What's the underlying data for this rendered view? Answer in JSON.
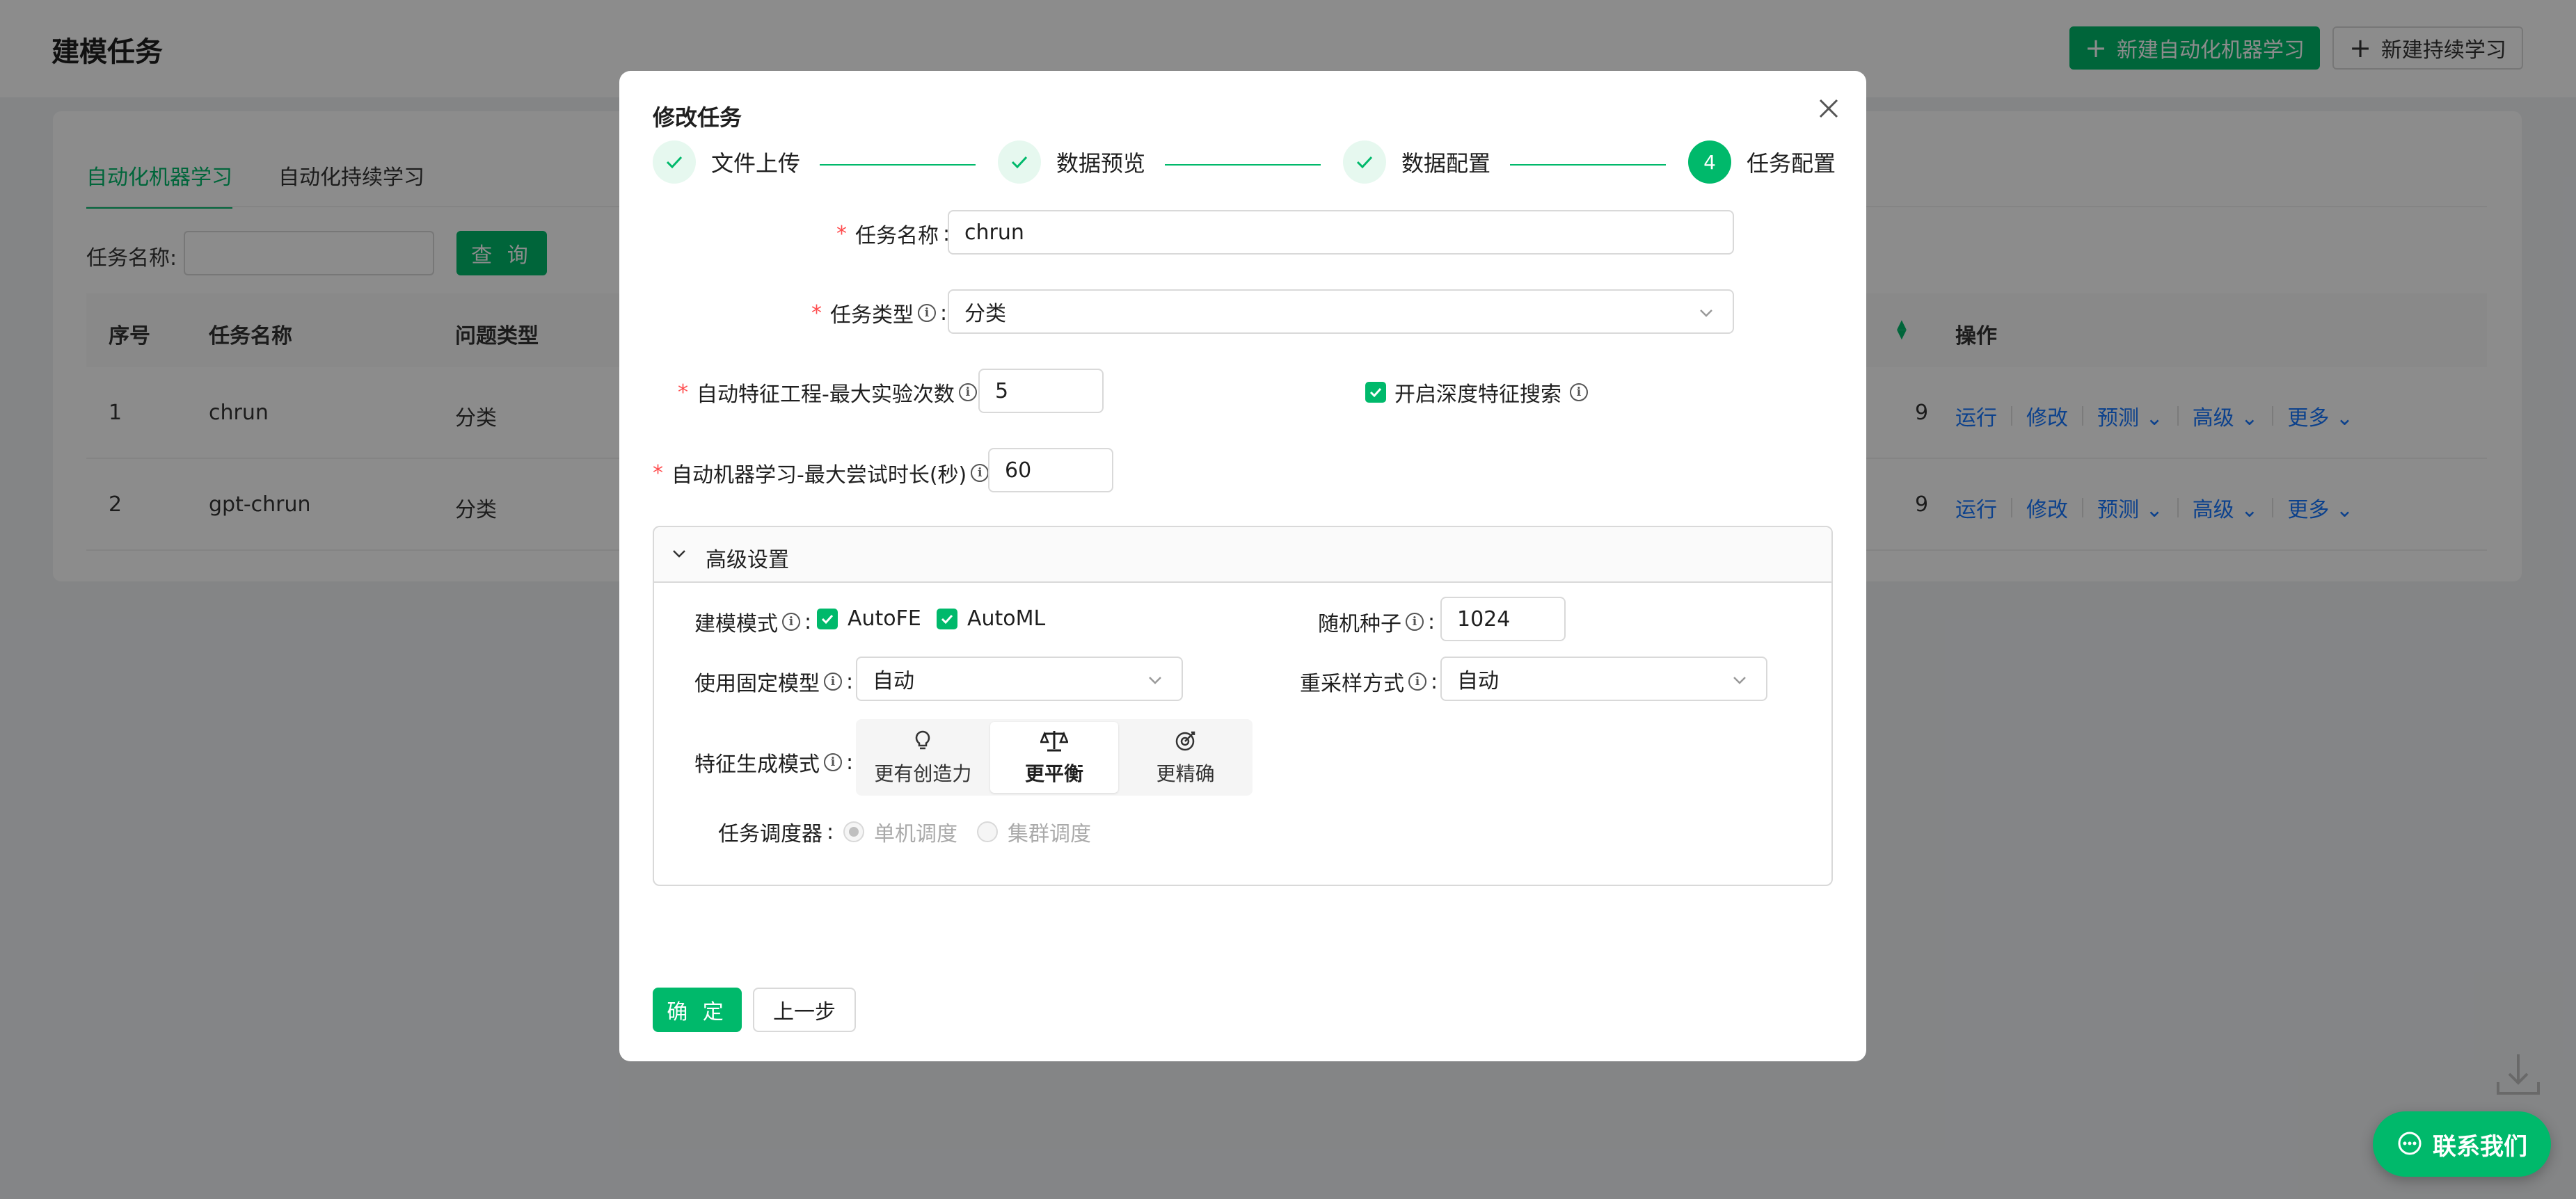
{
  "page": {
    "title": "建模任务",
    "header_buttons": {
      "new_automl": "新建自动化机器学习",
      "new_continuous": "新建持续学习"
    }
  },
  "list": {
    "tabs": [
      {
        "label": "自动化机器学习",
        "active": true
      },
      {
        "label": "自动化持续学习",
        "active": false
      }
    ],
    "search": {
      "label": "任务名称:",
      "value": "",
      "query_button": "查 询"
    },
    "columns": [
      "序号",
      "任务名称",
      "问题类型",
      "操作"
    ],
    "rows": [
      {
        "index": "1",
        "name": "chrun",
        "type": "分类",
        "partial": "9"
      },
      {
        "index": "2",
        "name": "gpt-chrun",
        "type": "分类",
        "partial": "9"
      }
    ],
    "actions": {
      "run": "运行",
      "edit": "修改",
      "predict": "预测",
      "advanced": "高级",
      "more": "更多"
    }
  },
  "modal": {
    "title": "修改任务",
    "steps": [
      {
        "label": "文件上传",
        "status": "done"
      },
      {
        "label": "数据预览",
        "status": "done"
      },
      {
        "label": "数据配置",
        "status": "done"
      },
      {
        "label": "任务配置",
        "status": "current",
        "number": "4"
      }
    ],
    "form": {
      "task_name": {
        "label": "任务名称",
        "value": "chrun"
      },
      "task_type": {
        "label": "任务类型",
        "value": "分类"
      },
      "max_trials": {
        "label": "自动特征工程-最大实验次数",
        "value": "5"
      },
      "deep_feature_search": {
        "label": "开启深度特征搜索",
        "checked": true
      },
      "max_duration": {
        "label": "自动机器学习-最大尝试时长(秒)",
        "value": "60"
      }
    },
    "advanced": {
      "title": "高级设置",
      "modeling_mode": {
        "label": "建模模式",
        "options": [
          {
            "label": "AutoFE",
            "checked": true
          },
          {
            "label": "AutoML",
            "checked": true
          }
        ]
      },
      "random_seed": {
        "label": "随机种子",
        "value": "1024"
      },
      "fixed_model": {
        "label": "使用固定模型",
        "value": "自动"
      },
      "resample": {
        "label": "重采样方式",
        "value": "自动"
      },
      "feature_mode": {
        "label": "特征生成模式",
        "options": [
          {
            "label": "更有创造力",
            "icon": "lightbulb-icon",
            "active": false
          },
          {
            "label": "更平衡",
            "icon": "balance-scale-icon",
            "active": true
          },
          {
            "label": "更精确",
            "icon": "target-icon",
            "active": false
          }
        ]
      },
      "scheduler": {
        "label": "任务调度器",
        "options": [
          {
            "label": "单机调度",
            "selected": true,
            "disabled": true
          },
          {
            "label": "集群调度",
            "selected": false,
            "disabled": true
          }
        ]
      }
    },
    "buttons": {
      "ok": "确 定",
      "prev": "上一步"
    }
  },
  "floating": {
    "contact": "联系我们"
  },
  "colors": {
    "primary": "#00b96b",
    "link": "#1677ff",
    "required": "#ff4d4f"
  }
}
